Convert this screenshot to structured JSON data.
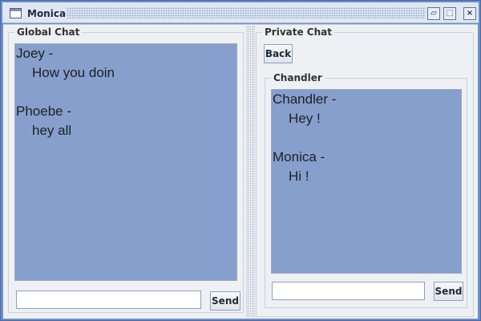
{
  "window": {
    "title": "Monica",
    "icons": {
      "app": "window-icon",
      "restore": "restore-icon",
      "maximize": "maximize-icon",
      "close": "close-icon"
    }
  },
  "global_chat": {
    "title": "Global Chat",
    "messages": [
      {
        "name": "Joey -",
        "text": "How you doin"
      },
      {
        "name": "Phoebe -",
        "text": "hey all"
      }
    ],
    "input_value": "",
    "send_label": "Send"
  },
  "private_chat": {
    "title": "Private Chat",
    "back_label": "Back",
    "conversation": {
      "title": "Chandler",
      "messages": [
        {
          "name": "Chandler -",
          "text": "Hey !"
        },
        {
          "name": "Monica -",
          "text": "Hi !"
        }
      ],
      "input_value": "",
      "send_label": "Send"
    }
  },
  "colors": {
    "window_blue": "#6d8fc9",
    "chat_background": "#879fcd",
    "panel_background": "#eef0f3"
  }
}
